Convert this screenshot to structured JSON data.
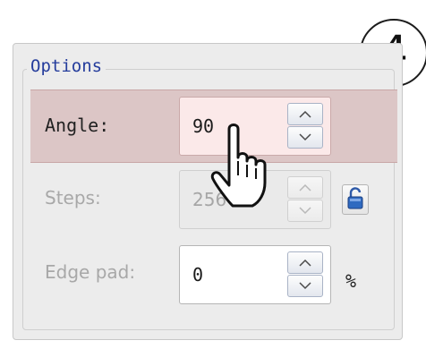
{
  "step_badge": "4",
  "group_title": "Options",
  "fields": [
    {
      "label": "Angle:",
      "value": "90",
      "state": "hover"
    },
    {
      "label": "Steps:",
      "value": "256",
      "state": "disabled"
    },
    {
      "label": "Edge pad:",
      "value": "0",
      "state": "normal",
      "unit": "%"
    }
  ],
  "icons": {
    "spin_up": "chevron-up-icon",
    "spin_down": "chevron-down-icon",
    "lock": "unlocked-padlock-icon",
    "cursor": "hand-pointer-icon"
  },
  "colors": {
    "group_title": "#243c9c",
    "highlight_row": "#dcc6c6",
    "highlight_field": "#fbe9e9",
    "panel_bg": "#ececec",
    "disabled_text": "#a8a8a8"
  }
}
